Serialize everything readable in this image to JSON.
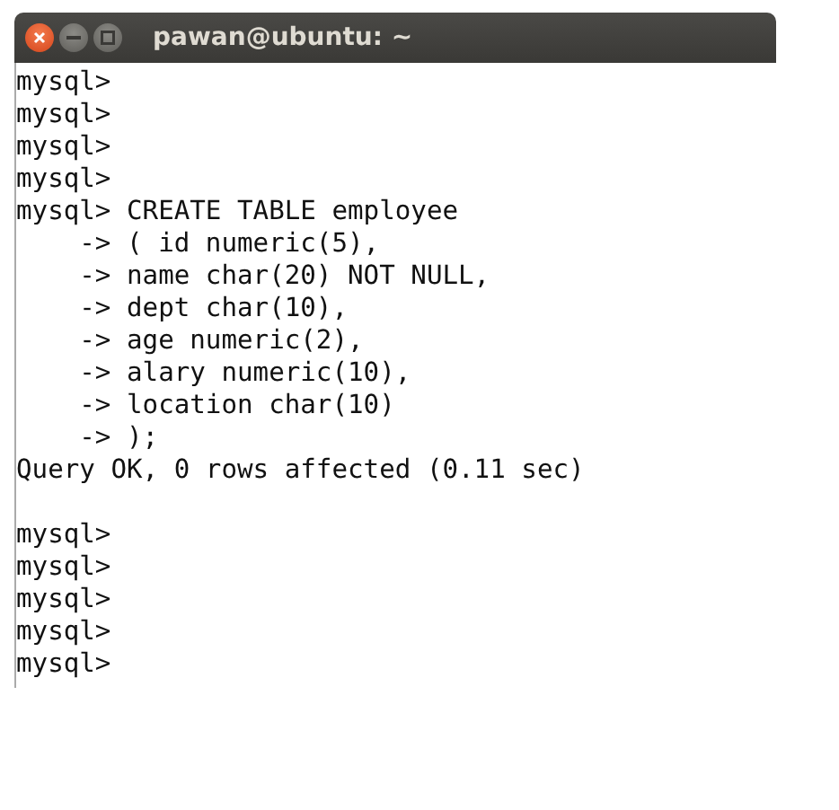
{
  "window": {
    "title": "pawan@ubuntu: ~"
  },
  "terminal": {
    "lines": [
      {
        "kind": "text",
        "text": "mysql>"
      },
      {
        "kind": "text",
        "text": "mysql>"
      },
      {
        "kind": "text",
        "text": "mysql>"
      },
      {
        "kind": "text",
        "text": "mysql>"
      },
      {
        "kind": "text",
        "text": "mysql> CREATE TABLE employee"
      },
      {
        "kind": "text",
        "text": "    -> ( id numeric(5),"
      },
      {
        "kind": "text",
        "text": "    -> name char(20) NOT NULL,"
      },
      {
        "kind": "text",
        "text": "    -> dept char(10),"
      },
      {
        "kind": "text",
        "text": "    -> age numeric(2),"
      },
      {
        "kind": "text",
        "text": "    -> alary numeric(10),"
      },
      {
        "kind": "text",
        "text": "    -> location char(10)"
      },
      {
        "kind": "text",
        "text": "    -> );"
      },
      {
        "kind": "text",
        "text": "Query OK, 0 rows affected (0.11 sec)"
      },
      {
        "kind": "blank"
      },
      {
        "kind": "text",
        "text": "mysql>"
      },
      {
        "kind": "text",
        "text": "mysql>"
      },
      {
        "kind": "text",
        "text": "mysql>"
      },
      {
        "kind": "text",
        "text": "mysql>"
      },
      {
        "kind": "text",
        "text": "mysql>"
      }
    ]
  }
}
